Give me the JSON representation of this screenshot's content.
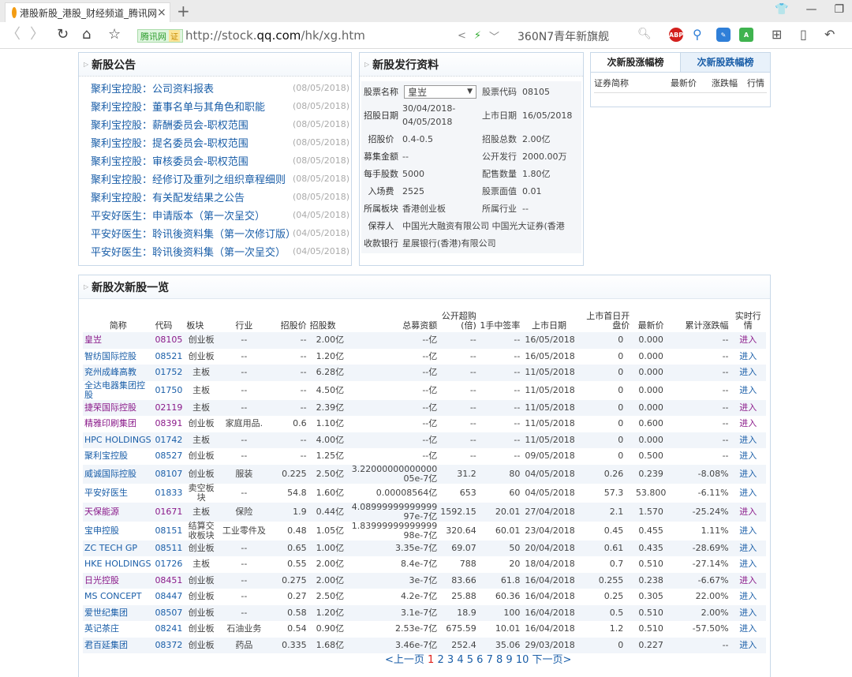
{
  "browser": {
    "tab_title": "港股新股_港股_财经频道_腾讯网",
    "tab_close": "×",
    "new_tab": "+",
    "cert_label": "腾讯网",
    "cert_badge": "证",
    "url_prefix": "http://stock.",
    "url_domain": "qq.com",
    "url_path": "/hk/xg.htm",
    "search_text": "360N7青年新旗舰",
    "ext_abp": "ABP"
  },
  "notices": {
    "title": "新股公告",
    "items": [
      {
        "text": "聚利宝控股：公司资料报表",
        "date": "(08/05/2018)"
      },
      {
        "text": "聚利宝控股：董事名单与其角色和职能",
        "date": "(08/05/2018)"
      },
      {
        "text": "聚利宝控股：薪酬委员会-职权范围",
        "date": "(08/05/2018)"
      },
      {
        "text": "聚利宝控股：提名委员会-职权范围",
        "date": "(08/05/2018)"
      },
      {
        "text": "聚利宝控股：审核委员会-职权范围",
        "date": "(08/05/2018)"
      },
      {
        "text": "聚利宝控股：经修订及重列之组织章程细则",
        "date": "(08/05/2018)"
      },
      {
        "text": "聚利宝控股：有关配发结果之公告",
        "date": "(08/05/2018)"
      },
      {
        "text": "平安好医生：申请版本（第一次呈交）",
        "date": "(04/05/2018)"
      },
      {
        "text": "平安好医生：聆讯後资料集（第一次修订版）",
        "date": "(04/05/2018)"
      },
      {
        "text": "平安好医生：聆讯後资料集（第一次呈交）",
        "date": "(04/05/2018)"
      }
    ]
  },
  "issue_info": {
    "title": "新股发行资料",
    "stock_name_label": "股票名称",
    "stock_name_value": "皇岦",
    "stock_code_label": "股票代码",
    "stock_code_value": "08105",
    "offer_date_label": "招股日期",
    "offer_date_value_1": "30/04/2018-",
    "offer_date_value_2": "04/05/2018",
    "listing_date_label": "上市日期",
    "listing_date_value": "16/05/2018",
    "offer_price_label": "招股价",
    "offer_price_value": "0.4-0.5",
    "offer_total_label": "招股总数",
    "offer_total_value": "2.00亿",
    "raised_label": "募集金额",
    "raised_value": "--",
    "public_label": "公开发行",
    "public_value": "2000.00万",
    "lot_label": "每手股数",
    "lot_value": "5000",
    "placing_label": "配售数量",
    "placing_value": "1.80亿",
    "entry_fee_label": "入场费",
    "entry_fee_value": "2525",
    "par_label": "股票面值",
    "par_value": "0.01",
    "board_label": "所属板块",
    "board_value": "香港创业板",
    "industry_label": "所属行业",
    "industry_value": "--",
    "sponsor_label": "保荐人",
    "sponsor_value": "中国光大融资有限公司 中国光大证券(香港",
    "bank_label": "收款银行",
    "bank_value": "星展银行(香港)有限公司"
  },
  "ranking": {
    "tab_gain": "次新股涨幅榜",
    "tab_loss": "次新股跌幅榜",
    "cols": [
      "证券简称",
      "最新价",
      "涨跌幅",
      "行情"
    ]
  },
  "ipo_table": {
    "title": "新股次新股一览",
    "headers": [
      "简称",
      "代码",
      "板块",
      "行业",
      "招股价",
      "招股数",
      "总募资额",
      "公开超购(倍)",
      "1手中签率",
      "上市日期",
      "上市首日开盘价",
      "最新价",
      "累计涨跌幅",
      "实时行情"
    ],
    "rows": [
      {
        "name": "皇岦",
        "code": "08105",
        "board": "创业板",
        "industry": "--",
        "price": "--",
        "shares": "2.00亿",
        "raised": "--亿",
        "oversub": "--",
        "rate": "--",
        "date": "16/05/2018",
        "open": "0",
        "last": "0.000",
        "chg": "--",
        "link": "进入",
        "visited": true,
        "dir": ""
      },
      {
        "name": "智纺国际控股",
        "code": "08521",
        "board": "创业板",
        "industry": "--",
        "price": "--",
        "shares": "1.20亿",
        "raised": "--亿",
        "oversub": "--",
        "rate": "--",
        "date": "16/05/2018",
        "open": "0",
        "last": "0.000",
        "chg": "--",
        "link": "进入",
        "visited": false,
        "dir": ""
      },
      {
        "name": "兖州成峰高教",
        "code": "01752",
        "board": "主板",
        "industry": "--",
        "price": "--",
        "shares": "6.28亿",
        "raised": "--亿",
        "oversub": "--",
        "rate": "--",
        "date": "11/05/2018",
        "open": "0",
        "last": "0.000",
        "chg": "--",
        "link": "进入",
        "visited": false,
        "dir": ""
      },
      {
        "name": "全达电器集团控股",
        "code": "01750",
        "board": "主板",
        "industry": "--",
        "price": "--",
        "shares": "4.50亿",
        "raised": "--亿",
        "oversub": "--",
        "rate": "--",
        "date": "11/05/2018",
        "open": "0",
        "last": "0.000",
        "chg": "--",
        "link": "进入",
        "visited": false,
        "dir": ""
      },
      {
        "name": "捷荣国际控股",
        "code": "02119",
        "board": "主板",
        "industry": "--",
        "price": "--",
        "shares": "2.39亿",
        "raised": "--亿",
        "oversub": "--",
        "rate": "--",
        "date": "11/05/2018",
        "open": "0",
        "last": "0.000",
        "chg": "--",
        "link": "进入",
        "visited": true,
        "dir": ""
      },
      {
        "name": "精雅印刷集团",
        "code": "08391",
        "board": "创业板",
        "industry": "家庭用品.",
        "price": "0.6",
        "shares": "1.10亿",
        "raised": "--亿",
        "oversub": "--",
        "rate": "--",
        "date": "11/05/2018",
        "open": "0",
        "last": "0.600",
        "chg": "--",
        "link": "进入",
        "visited": true,
        "dir": ""
      },
      {
        "name": "HPC HOLDINGS",
        "code": "01742",
        "board": "主板",
        "industry": "--",
        "price": "--",
        "shares": "4.00亿",
        "raised": "--亿",
        "oversub": "--",
        "rate": "--",
        "date": "11/05/2018",
        "open": "0",
        "last": "0.000",
        "chg": "--",
        "link": "进入",
        "visited": false,
        "dir": ""
      },
      {
        "name": "聚利宝控股",
        "code": "08527",
        "board": "创业板",
        "industry": "--",
        "price": "--",
        "shares": "1.25亿",
        "raised": "--亿",
        "oversub": "--",
        "rate": "--",
        "date": "09/05/2018",
        "open": "0",
        "last": "0.500",
        "chg": "--",
        "link": "进入",
        "visited": false,
        "dir": ""
      },
      {
        "name": "威诚国际控股",
        "code": "08107",
        "board": "创业板",
        "industry": "服装",
        "price": "0.225",
        "shares": "2.50亿",
        "raised": "3.2200000000000005e-7亿",
        "oversub": "31.2",
        "rate": "80",
        "date": "04/05/2018",
        "open": "0.26",
        "last": "0.239",
        "chg": "-8.08%",
        "link": "进入",
        "visited": false,
        "dir": "down"
      },
      {
        "name": "平安好医生",
        "code": "01833",
        "board": "卖空板块",
        "industry": "--",
        "price": "54.8",
        "shares": "1.60亿",
        "raised": "0.00008564亿",
        "oversub": "653",
        "rate": "60",
        "date": "04/05/2018",
        "open": "57.3",
        "last": "53.800",
        "chg": "-6.11%",
        "link": "进入",
        "visited": false,
        "dir": "down"
      },
      {
        "name": "天保能源",
        "code": "01671",
        "board": "主板",
        "industry": "保险",
        "price": "1.9",
        "shares": "0.44亿",
        "raised": "4.0899999999999997e-7亿",
        "oversub": "1592.15",
        "rate": "20.01",
        "date": "27/04/2018",
        "open": "2.1",
        "last": "1.570",
        "chg": "-25.24%",
        "link": "进入",
        "visited": true,
        "dir": "down"
      },
      {
        "name": "宝申控股",
        "code": "08151",
        "board": "结算交收板块",
        "industry": "工业零件及",
        "price": "0.48",
        "shares": "1.05亿",
        "raised": "1.8399999999999998e-7亿",
        "oversub": "320.64",
        "rate": "60.01",
        "date": "23/04/2018",
        "open": "0.45",
        "last": "0.455",
        "chg": "1.11%",
        "link": "进入",
        "visited": false,
        "dir": "up"
      },
      {
        "name": "ZC TECH GP",
        "code": "08511",
        "board": "创业板",
        "industry": "--",
        "price": "0.65",
        "shares": "1.00亿",
        "raised": "3.35e-7亿",
        "oversub": "69.07",
        "rate": "50",
        "date": "20/04/2018",
        "open": "0.61",
        "last": "0.435",
        "chg": "-28.69%",
        "link": "进入",
        "visited": false,
        "dir": "down"
      },
      {
        "name": "HKE HOLDINGS",
        "code": "01726",
        "board": "主板",
        "industry": "--",
        "price": "0.55",
        "shares": "2.00亿",
        "raised": "8.4e-7亿",
        "oversub": "788",
        "rate": "20",
        "date": "18/04/2018",
        "open": "0.7",
        "last": "0.510",
        "chg": "-27.14%",
        "link": "进入",
        "visited": false,
        "dir": "down"
      },
      {
        "name": "日光控股",
        "code": "08451",
        "board": "创业板",
        "industry": "--",
        "price": "0.275",
        "shares": "2.00亿",
        "raised": "3e-7亿",
        "oversub": "83.66",
        "rate": "61.8",
        "date": "16/04/2018",
        "open": "0.255",
        "last": "0.238",
        "chg": "-6.67%",
        "link": "进入",
        "visited": true,
        "dir": "down"
      },
      {
        "name": "MS CONCEPT",
        "code": "08447",
        "board": "创业板",
        "industry": "--",
        "price": "0.27",
        "shares": "2.50亿",
        "raised": "4.2e-7亿",
        "oversub": "25.88",
        "rate": "60.36",
        "date": "16/04/2018",
        "open": "0.25",
        "last": "0.305",
        "chg": "22.00%",
        "link": "进入",
        "visited": false,
        "dir": "up"
      },
      {
        "name": "爱世纪集团",
        "code": "08507",
        "board": "创业板",
        "industry": "--",
        "price": "0.58",
        "shares": "1.20亿",
        "raised": "3.1e-7亿",
        "oversub": "18.9",
        "rate": "100",
        "date": "16/04/2018",
        "open": "0.5",
        "last": "0.510",
        "chg": "2.00%",
        "link": "进入",
        "visited": false,
        "dir": "up"
      },
      {
        "name": "英记茶庄",
        "code": "08241",
        "board": "创业板",
        "industry": "石油业务",
        "price": "0.54",
        "shares": "0.90亿",
        "raised": "2.53e-7亿",
        "oversub": "675.59",
        "rate": "10.01",
        "date": "16/04/2018",
        "open": "1.2",
        "last": "0.510",
        "chg": "-57.50%",
        "link": "进入",
        "visited": false,
        "dir": "down"
      },
      {
        "name": "君百延集团",
        "code": "08372",
        "board": "创业板",
        "industry": "药品",
        "price": "0.335",
        "shares": "1.68亿",
        "raised": "3.46e-7亿",
        "oversub": "252.4",
        "rate": "35.06",
        "date": "29/03/2018",
        "open": "0",
        "last": "0.227",
        "chg": "--",
        "link": "进入",
        "visited": false,
        "dir": ""
      }
    ]
  },
  "pager": {
    "prev": "<上一页",
    "current": "1",
    "pages": [
      "2",
      "3",
      "4",
      "5",
      "6",
      "7",
      "8",
      "9",
      "10"
    ],
    "next": "下一页>"
  },
  "colors": {
    "link": "#1a5ea8",
    "visited": "#8a1a8a",
    "up": "#e0201a",
    "down": "#2e9e2e"
  }
}
